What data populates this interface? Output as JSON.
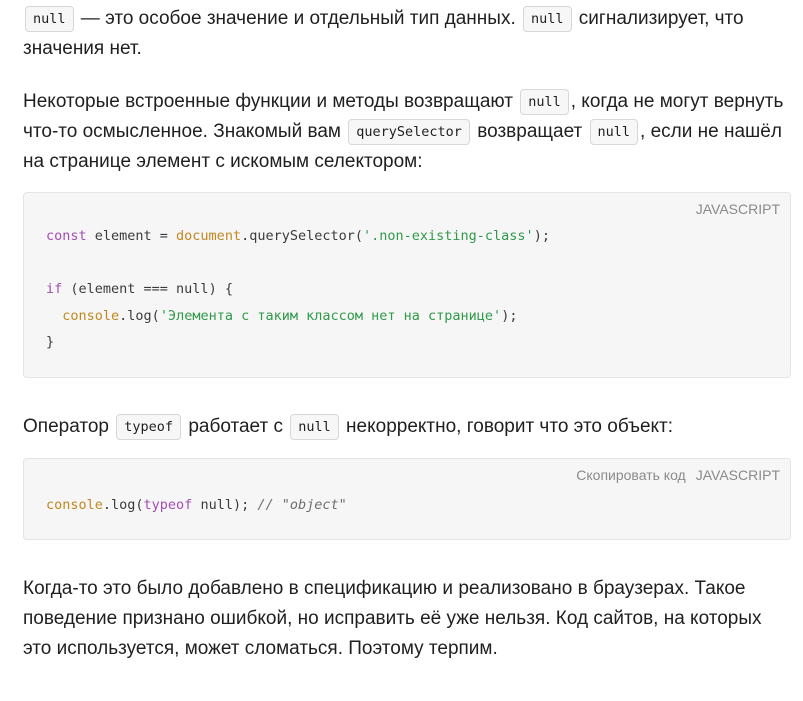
{
  "para1": {
    "code1": "null",
    "text1": " — это особое значение и отдельный тип данных. ",
    "code2": "null",
    "text2": " сигнализирует, что значения нет."
  },
  "para2": {
    "text1": "Некоторые встроенные функции и методы возвращают ",
    "code1": "null",
    "text2": ", когда не могут вернуть что-то осмысленное. Знакомый вам ",
    "code2": "querySelector",
    "text3": " возвращает ",
    "code3": "null",
    "text4": ", если не нашёл на странице элемент с искомым селектором:"
  },
  "code_block_1": {
    "language": "JAVASCRIPT",
    "line1": {
      "kw": "const",
      "a": " element = ",
      "obj": "document",
      "b": ".querySelector(",
      "str": "'.non-existing-class'",
      "c": ");"
    },
    "line3": {
      "kw": "if",
      "a": " (element === null) {"
    },
    "line4": {
      "indent": "  ",
      "obj": "console",
      "a": ".log(",
      "str": "'Элемента с таким классом нет на странице'",
      "b": ");"
    },
    "line5": {
      "a": "}"
    }
  },
  "para3": {
    "text1": "Оператор ",
    "code1": "typeof",
    "text2": " работает с ",
    "code2": "null",
    "text3": " некорректно, говорит что это объект:"
  },
  "code_block_2": {
    "copy_label": "Скопировать код",
    "language": "JAVASCRIPT",
    "line1": {
      "obj": "console",
      "a": ".log(",
      "kw": "typeof",
      "b": " null); ",
      "cm": "// \"object\""
    }
  },
  "para4": {
    "text": "Когда-то это было добавлено в спецификацию и реализовано в браузерах. Такое поведение признано ошибкой, но исправить её уже нельзя. Код сайтов, на которых это используется, может сломаться. Поэтому терпим."
  },
  "colors": {
    "keyword": "#a44db3",
    "object": "#c28820",
    "string": "#2f9a4a",
    "comment": "#6e6e6e",
    "code_bg": "#f6f6f6"
  }
}
